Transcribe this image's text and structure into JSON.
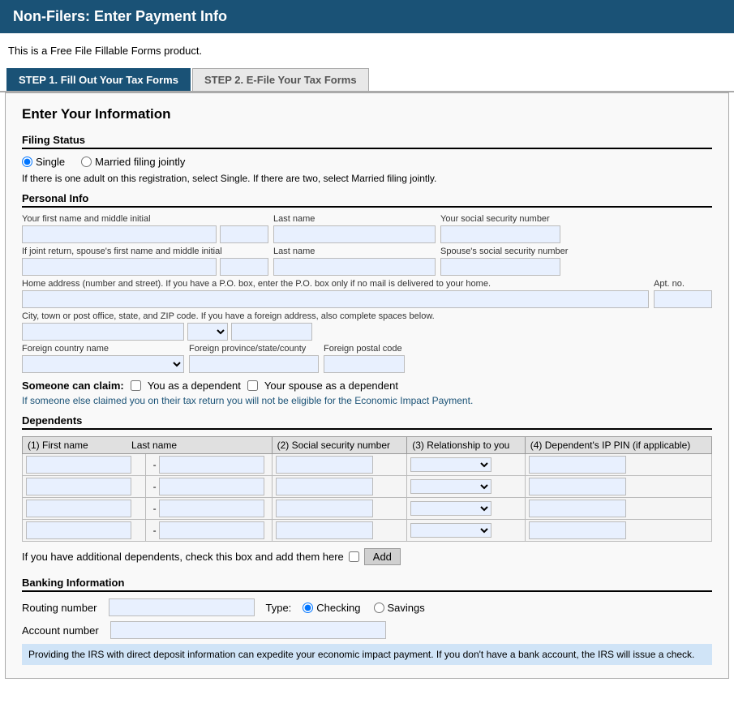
{
  "header": {
    "title": "Non-Filers: Enter Payment Info"
  },
  "subtitle": "This is a Free File Fillable Forms product.",
  "tabs": [
    {
      "id": "step1",
      "label": "STEP 1. Fill Out Your Tax Forms",
      "active": true
    },
    {
      "id": "step2",
      "label": "STEP 2. E-File Your Tax Forms",
      "active": false
    }
  ],
  "form": {
    "title": "Enter Your Information",
    "filing_status": {
      "label": "Filing Status",
      "options": [
        {
          "label": "Single",
          "checked": true
        },
        {
          "label": "Married filing jointly",
          "checked": false
        }
      ],
      "note": "If there is one adult on this registration, select Single. If there are two, select Married filing jointly."
    },
    "personal_info": {
      "label": "Personal Info",
      "fields": {
        "first_name_label": "Your first name and middle initial",
        "last_name_label": "Last name",
        "ssn_label": "Your social security number",
        "joint_first_label": "If joint return, spouse's first name and middle initial",
        "joint_last_label": "Last name",
        "joint_ssn_label": "Spouse's social security number",
        "address_label": "Home address (number and street). If you have a P.O. box, enter the P.O. box only if no mail is delivered to your home.",
        "apt_label": "Apt. no.",
        "city_label": "City, town or post office, state, and ZIP code. If you have a foreign address, also complete spaces below.",
        "foreign_country_label": "Foreign country name",
        "foreign_province_label": "Foreign province/state/county",
        "foreign_postal_label": "Foreign postal code"
      }
    },
    "someone_claim": {
      "label": "Someone can claim:",
      "option1": "You as a dependent",
      "option2": "Your spouse as a dependent",
      "note": "If someone else claimed you on their tax return you will not be eligible for the Economic Impact Payment."
    },
    "dependents": {
      "label": "Dependents",
      "columns": [
        "(1) First name",
        "Last name",
        "(2) Social security number",
        "(3) Relationship to you",
        "(4) Dependent's IP PIN (if applicable)"
      ],
      "rows": [
        {
          "first": "",
          "last": "",
          "ssn": "",
          "rel": "",
          "pin": ""
        },
        {
          "first": "",
          "last": "",
          "ssn": "",
          "rel": "",
          "pin": ""
        },
        {
          "first": "",
          "last": "",
          "ssn": "",
          "rel": "",
          "pin": ""
        },
        {
          "first": "",
          "last": "",
          "ssn": "",
          "rel": "",
          "pin": ""
        }
      ],
      "add_note": "If you have additional dependents, check this box and add them here",
      "add_button": "Add"
    },
    "banking": {
      "label": "Banking Information",
      "routing_label": "Routing number",
      "account_label": "Account number",
      "type_label": "Type:",
      "type_options": [
        "Checking",
        "Savings"
      ],
      "note": "Providing the IRS with direct deposit information can expedite your economic impact payment. If you don't have a bank account, the IRS will issue a check."
    }
  }
}
